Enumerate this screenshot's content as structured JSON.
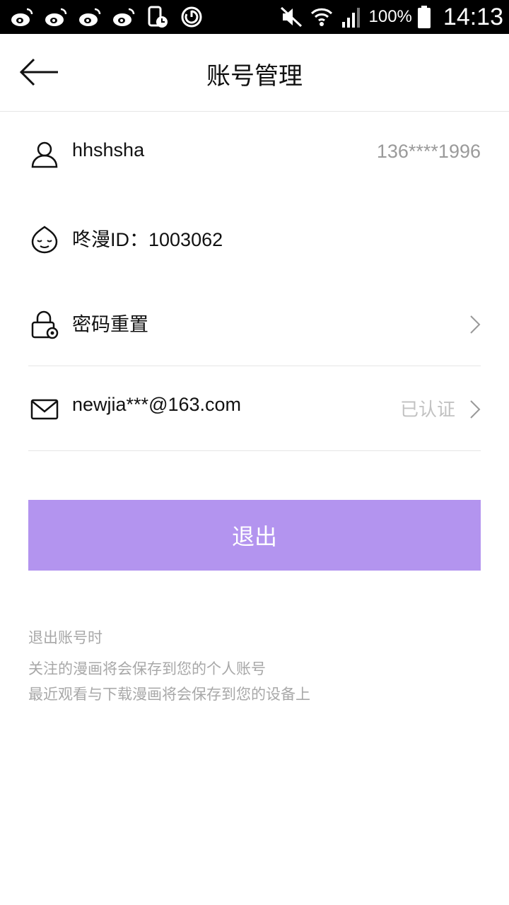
{
  "status_bar": {
    "left_icons": [
      "weibo-icon",
      "weibo-icon",
      "weibo-icon",
      "weibo-icon",
      "phone-clock-icon",
      "sync-icon"
    ],
    "battery": "100%",
    "time": "14:13"
  },
  "header": {
    "title": "账号管理"
  },
  "account": {
    "username": "hhshsha",
    "phone": "136****1996",
    "id_label": "咚漫ID：1003062",
    "password_reset": "密码重置",
    "email": "newjia***@163.com",
    "email_status": "已认证"
  },
  "logout": {
    "label": "退出"
  },
  "notes": {
    "title": "退出账号时",
    "line1": "关注的漫画将会保存到您的个人账号",
    "line2": "最近观看与下载漫画将会保存到您的设备上"
  },
  "colors": {
    "accent": "#b394ef",
    "divider": "#e6e6e6",
    "muted_text": "#9a9a9a"
  }
}
